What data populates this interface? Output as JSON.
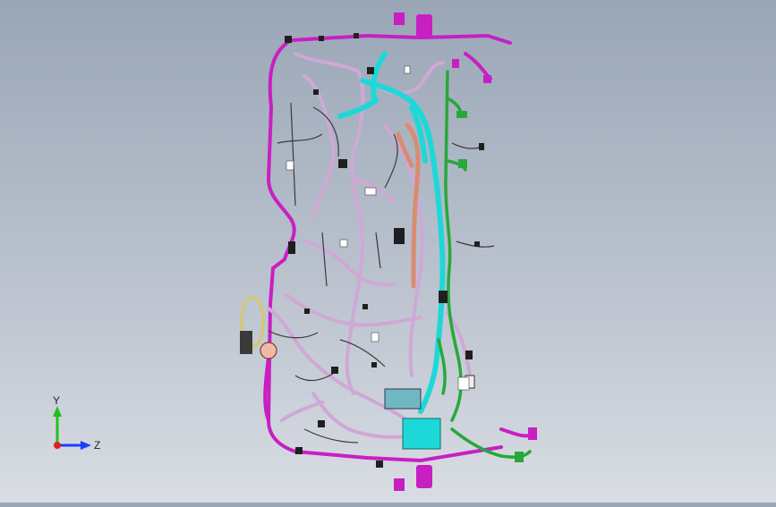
{
  "viewport": {
    "background_top": "#9aa6b6",
    "background_bottom": "#d9dde3"
  },
  "model": {
    "colors": {
      "magenta": "#c81fc3",
      "light_purple": "#cfa8d6",
      "cyan": "#1ed8d8",
      "green": "#27a83a",
      "salmon": "#d98c72",
      "dark": "#2a2a2a"
    }
  },
  "triad": {
    "x_label": "",
    "y_label": "Y",
    "z_label": "Z",
    "y_color": "#20c020",
    "z_color": "#1f3cff",
    "origin_color": "#e02020"
  }
}
